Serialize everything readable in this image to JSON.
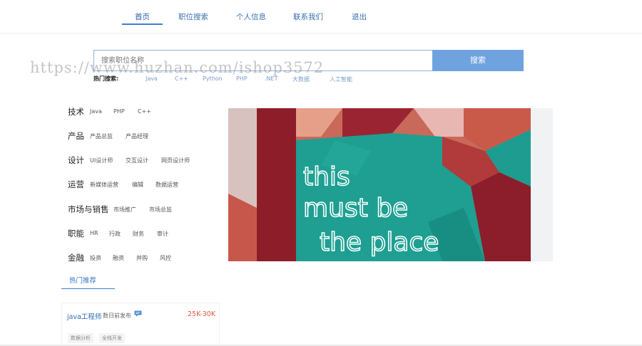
{
  "nav": {
    "items": [
      {
        "label": "首页",
        "active": true
      },
      {
        "label": "职位搜索",
        "active": false
      },
      {
        "label": "个人信息",
        "active": false
      },
      {
        "label": "联系我们",
        "active": false
      },
      {
        "label": "退出",
        "active": false
      }
    ]
  },
  "search": {
    "placeholder": "搜索职位名称",
    "button_label": "搜索",
    "hot_label": "热门搜索:",
    "hot_keywords": [
      "Java",
      "C++",
      "Python",
      "PHP",
      ".NET",
      "大数据",
      "人工智能"
    ]
  },
  "watermark": "https://www.huzhan.com/ishop3572",
  "categories": [
    {
      "title": "技术",
      "tags": [
        "Java",
        "PHP",
        "C++"
      ]
    },
    {
      "title": "产品",
      "tags": [
        "产品总监",
        "产品经理"
      ]
    },
    {
      "title": "设计",
      "tags": [
        "UI设计师",
        "交互设计",
        "网页设计师"
      ]
    },
    {
      "title": "运营",
      "tags": [
        "新媒体运营",
        "编辑",
        "数据运营"
      ]
    },
    {
      "title": "市场与销售",
      "tags": [
        "市场推广",
        "市场总监"
      ]
    },
    {
      "title": "职能",
      "tags": [
        "HR",
        "行政",
        "财务",
        "审计"
      ]
    },
    {
      "title": "金融",
      "tags": [
        "投资",
        "融资",
        "并购",
        "风控"
      ]
    }
  ],
  "recommend": {
    "title": "热门推荐",
    "job": {
      "name": "java工程师",
      "time": "数日前发布",
      "salary": "25K-30K",
      "tags": [
        "数据分析",
        "全栈开发"
      ]
    }
  },
  "banner": {
    "lines": [
      "this",
      "must be",
      "the place"
    ]
  },
  "colors": {
    "accent": "#3f7fd1",
    "search_button": "#6fa3df",
    "salary": "#e05a3f",
    "neon_wall": "#1f9e92"
  }
}
